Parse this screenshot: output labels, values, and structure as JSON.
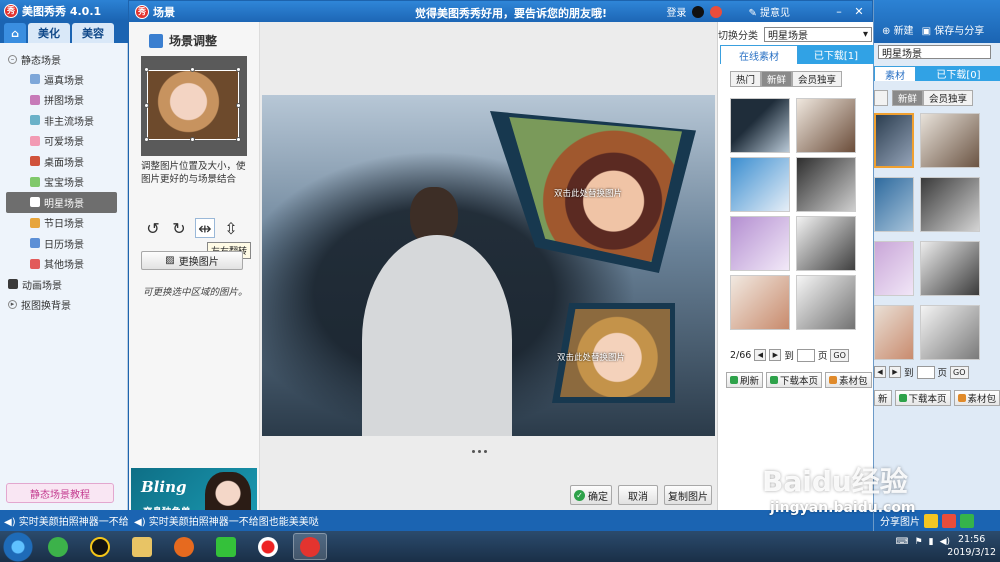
{
  "app": {
    "title": "美图秀秀 4.0.1",
    "logo_text": "秀"
  },
  "main_tabs": [
    {
      "label": "美化"
    },
    {
      "label": "美容"
    }
  ],
  "sidebar": {
    "group_static": "静态场景",
    "items": [
      {
        "label": "逼真场景",
        "color": "#7ea7d9"
      },
      {
        "label": "拼图场景",
        "color": "#c77ab8"
      },
      {
        "label": "非主流场景",
        "color": "#6bb1c8"
      },
      {
        "label": "可爱场景",
        "color": "#f29ab3"
      },
      {
        "label": "桌面场景",
        "color": "#d0523b"
      },
      {
        "label": "宝宝场景",
        "color": "#7fc86a"
      },
      {
        "label": "明星场景",
        "color": "#444444"
      },
      {
        "label": "节日场景",
        "color": "#e7a53c"
      },
      {
        "label": "日历场景",
        "color": "#5c8fd6"
      },
      {
        "label": "其他场景",
        "color": "#e25b5b"
      }
    ],
    "group_animated": "动画场景",
    "group_cutout": "抠图换背景",
    "tutorial": "静态场景教程"
  },
  "dialog": {
    "title": "场景",
    "slogan": "觉得美图秀秀好用，要告诉您的朋友哦!",
    "login": "登录",
    "feedback": "提意见",
    "adjust_title": "场景调整",
    "adjust_desc": "调整图片位置及大小，使图片更好的与场景结合",
    "tooltip": "左右翻转",
    "replace_label": "更换图片",
    "hand_note": "可更换选中区域的图片。",
    "banner_title": "Bling",
    "banner_sub": "变身独角兽",
    "hint_text": "双击此处替换图片",
    "confirm": "确定",
    "cancel": "取消",
    "copy_image": "复制图片"
  },
  "materials": {
    "switch_label": "切换分类",
    "category": "明星场景",
    "tab_online": "在线素材",
    "tab_downloaded": "已下载[1]",
    "filters": [
      "热门",
      "新鲜",
      "会员独享"
    ],
    "page": "2/66",
    "goto": "到",
    "page_unit": "页",
    "go": "GO",
    "actions": [
      "刷新",
      "下载本页",
      "素材包"
    ]
  },
  "bg_right": {
    "new_label": "新建",
    "save_share": "保存与分享",
    "category": "明星场景",
    "tab_online": "素材",
    "tab_downloaded": "已下载[0]",
    "filters": [
      "",
      "新鲜",
      "会员独享"
    ],
    "goto": "到",
    "page_unit": "页",
    "go": "GO",
    "actions": [
      "新",
      "下载本页",
      "素材包"
    ],
    "share_image": "分享图片"
  },
  "status": {
    "left": "实时美颜拍照神器一不给图",
    "mid": "实时美颜拍照神器一不给图也能美美哒"
  },
  "taskbar": {
    "time": "21:56",
    "date": "2019/3/12"
  },
  "watermark": {
    "brand": "Baidu经验",
    "url": "jingyan.baidu.com"
  }
}
